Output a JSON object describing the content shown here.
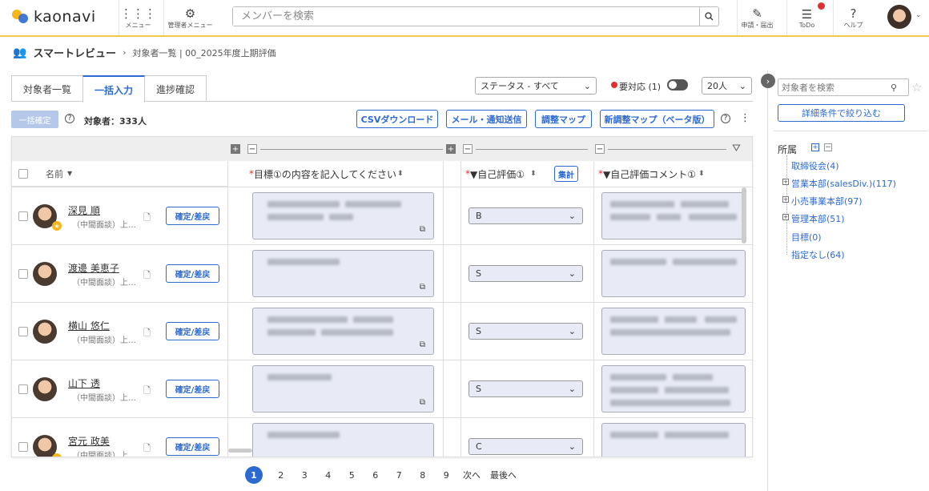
{
  "brand": {
    "name": "kaonavi"
  },
  "header": {
    "menu_label": "メニュー",
    "admin_menu_label": "管理者メニュー",
    "search_placeholder": "メンバーを検索",
    "apply_label": "申請・届出",
    "todo_label": "ToDo",
    "help_label": "ヘルプ"
  },
  "breadcrumb": {
    "title": "スマートレビュー",
    "path": "対象者一覧 | 00_2025年度上期評価"
  },
  "tabs": [
    {
      "label": "対象者一覧"
    },
    {
      "label": "一括入力"
    },
    {
      "label": "進捗確認"
    }
  ],
  "filters": {
    "status": "ステータス - すべて",
    "needs_action": "要対応 (1)",
    "per_page": "20人"
  },
  "toolbar": {
    "bulk_confirm": "一括確定",
    "target_count": "対象者：333人",
    "csv": "CSVダウンロード",
    "mail": "メール・通知送信",
    "adjust_map": "調整マップ",
    "new_adjust_map": "新調整マップ（ベータ版）"
  },
  "columns": {
    "name": "名前",
    "goal": "目標①の内容を記入してください",
    "self_eval": "▼自己評価①",
    "aggregate": "集計",
    "self_comment": "▼自己評価コメント①",
    "required_mark": "*"
  },
  "rows": [
    {
      "name": "深見 順",
      "sub": "（中間面談）上…",
      "btn": "確定/差戻",
      "eval": "B"
    },
    {
      "name": "渡邊 美恵子",
      "sub": "（中間面談）上…",
      "btn": "確定/差戻",
      "eval": "S"
    },
    {
      "name": "横山 悠仁",
      "sub": "（中間面談）上…",
      "btn": "確定/差戻",
      "eval": "S"
    },
    {
      "name": "山下 透",
      "sub": "（中間面談）上…",
      "btn": "確定/差戻",
      "eval": "S"
    },
    {
      "name": "宮元 政美",
      "sub": "（中間面談）上…",
      "btn": "確定/差戻",
      "eval": "C"
    }
  ],
  "pagination": {
    "pages": [
      "1",
      "2",
      "3",
      "4",
      "5",
      "6",
      "7",
      "8",
      "9"
    ],
    "next": "次へ",
    "last": "最後へ"
  },
  "sidebar": {
    "search_placeholder": "対象者を検索",
    "detail_filter": "詳細条件で絞り込む",
    "section": "所属",
    "tree": [
      "取締役会(4)",
      "営業本部(salesDiv.)(117)",
      "小売事業本部(97)",
      "管理本部(51)",
      "目標(0)",
      "指定なし(64)"
    ]
  },
  "colors": {
    "accent": "#2c6ad1",
    "alert": "#e03131",
    "header_border": "#f2c94c"
  }
}
